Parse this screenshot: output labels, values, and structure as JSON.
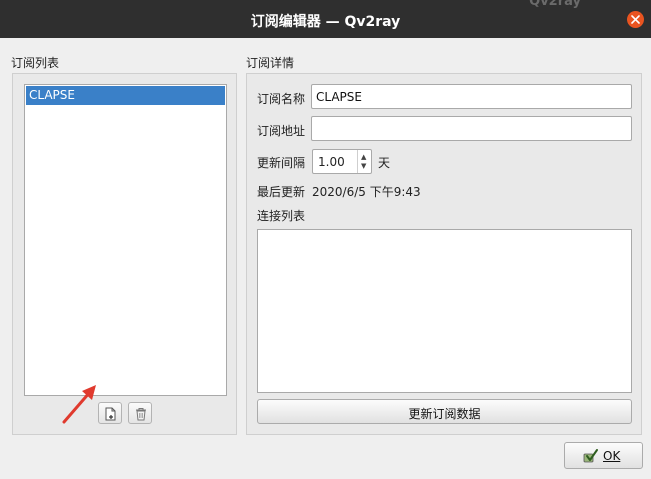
{
  "titlebar": {
    "title": "订阅编辑器 — Qv2ray",
    "background_app_title": "Qv2ray"
  },
  "subscription_list": {
    "group_label": "订阅列表",
    "items": [
      {
        "label": "CLAPSE",
        "selected": true
      }
    ]
  },
  "details": {
    "group_label": "订阅详情",
    "name_label": "订阅名称",
    "name_value": "CLAPSE",
    "address_label": "订阅地址",
    "address_value": "",
    "interval_label": "更新间隔",
    "interval_value": "1.00",
    "interval_unit": "天",
    "last_update_label": "最后更新",
    "last_update_value": "2020/6/5 下午9:43",
    "connection_list_label": "连接列表",
    "update_button": "更新订阅数据"
  },
  "footer": {
    "ok_button": "OK"
  },
  "colors": {
    "titlebar": "#2f2f2f",
    "close_button": "#e95420",
    "selection": "#3a80c8",
    "annotation_arrow": "#e03a2e"
  },
  "icons": {
    "add": "add-document-icon",
    "delete": "trash-icon",
    "ok": "checkmark-icon",
    "close": "close-icon"
  }
}
